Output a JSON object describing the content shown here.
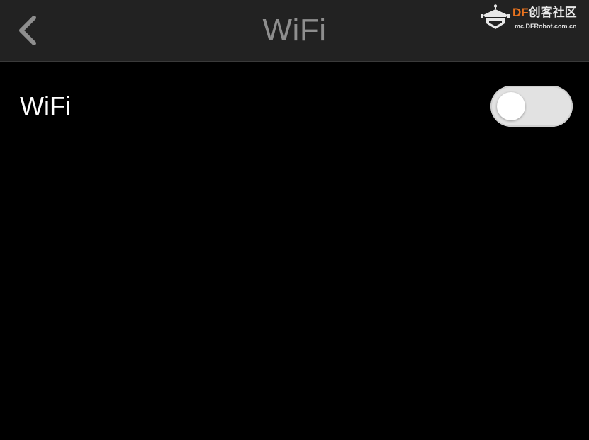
{
  "nav": {
    "title": "WiFi",
    "back_icon": "chevron-left-icon"
  },
  "watermark": {
    "brand_df": "DF",
    "brand_cn": "创客社区",
    "url": "mc.DFRobot.com.cn",
    "logo_icon": "robot-logo-icon",
    "brand_color": "#e8731f"
  },
  "settings": {
    "wifi": {
      "label": "WiFi",
      "enabled": false
    }
  },
  "colors": {
    "background": "#000000",
    "nav_background": "#222222",
    "title_color": "#8e8e8e",
    "toggle_off_track": "#e2e2e2"
  }
}
